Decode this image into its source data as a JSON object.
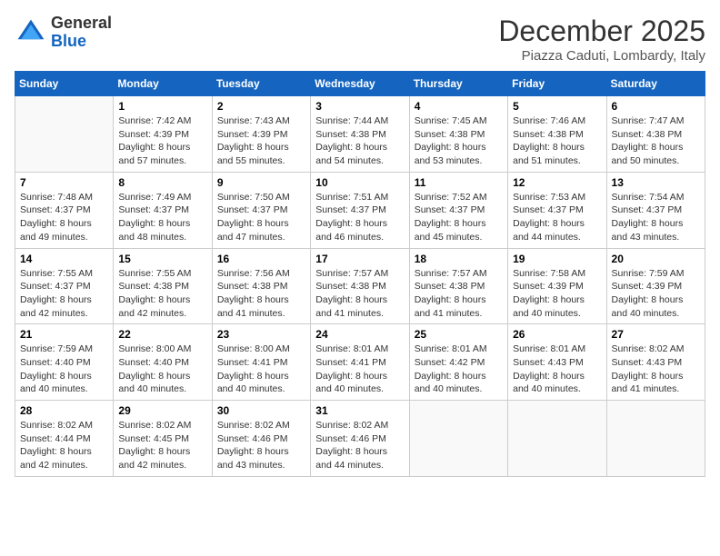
{
  "header": {
    "logo_general": "General",
    "logo_blue": "Blue",
    "month_title": "December 2025",
    "location": "Piazza Caduti, Lombardy, Italy"
  },
  "days_of_week": [
    "Sunday",
    "Monday",
    "Tuesday",
    "Wednesday",
    "Thursday",
    "Friday",
    "Saturday"
  ],
  "weeks": [
    [
      {
        "day": "",
        "sunrise": "",
        "sunset": "",
        "daylight": ""
      },
      {
        "day": "1",
        "sunrise": "Sunrise: 7:42 AM",
        "sunset": "Sunset: 4:39 PM",
        "daylight": "Daylight: 8 hours and 57 minutes."
      },
      {
        "day": "2",
        "sunrise": "Sunrise: 7:43 AM",
        "sunset": "Sunset: 4:39 PM",
        "daylight": "Daylight: 8 hours and 55 minutes."
      },
      {
        "day": "3",
        "sunrise": "Sunrise: 7:44 AM",
        "sunset": "Sunset: 4:38 PM",
        "daylight": "Daylight: 8 hours and 54 minutes."
      },
      {
        "day": "4",
        "sunrise": "Sunrise: 7:45 AM",
        "sunset": "Sunset: 4:38 PM",
        "daylight": "Daylight: 8 hours and 53 minutes."
      },
      {
        "day": "5",
        "sunrise": "Sunrise: 7:46 AM",
        "sunset": "Sunset: 4:38 PM",
        "daylight": "Daylight: 8 hours and 51 minutes."
      },
      {
        "day": "6",
        "sunrise": "Sunrise: 7:47 AM",
        "sunset": "Sunset: 4:38 PM",
        "daylight": "Daylight: 8 hours and 50 minutes."
      }
    ],
    [
      {
        "day": "7",
        "sunrise": "Sunrise: 7:48 AM",
        "sunset": "Sunset: 4:37 PM",
        "daylight": "Daylight: 8 hours and 49 minutes."
      },
      {
        "day": "8",
        "sunrise": "Sunrise: 7:49 AM",
        "sunset": "Sunset: 4:37 PM",
        "daylight": "Daylight: 8 hours and 48 minutes."
      },
      {
        "day": "9",
        "sunrise": "Sunrise: 7:50 AM",
        "sunset": "Sunset: 4:37 PM",
        "daylight": "Daylight: 8 hours and 47 minutes."
      },
      {
        "day": "10",
        "sunrise": "Sunrise: 7:51 AM",
        "sunset": "Sunset: 4:37 PM",
        "daylight": "Daylight: 8 hours and 46 minutes."
      },
      {
        "day": "11",
        "sunrise": "Sunrise: 7:52 AM",
        "sunset": "Sunset: 4:37 PM",
        "daylight": "Daylight: 8 hours and 45 minutes."
      },
      {
        "day": "12",
        "sunrise": "Sunrise: 7:53 AM",
        "sunset": "Sunset: 4:37 PM",
        "daylight": "Daylight: 8 hours and 44 minutes."
      },
      {
        "day": "13",
        "sunrise": "Sunrise: 7:54 AM",
        "sunset": "Sunset: 4:37 PM",
        "daylight": "Daylight: 8 hours and 43 minutes."
      }
    ],
    [
      {
        "day": "14",
        "sunrise": "Sunrise: 7:55 AM",
        "sunset": "Sunset: 4:37 PM",
        "daylight": "Daylight: 8 hours and 42 minutes."
      },
      {
        "day": "15",
        "sunrise": "Sunrise: 7:55 AM",
        "sunset": "Sunset: 4:38 PM",
        "daylight": "Daylight: 8 hours and 42 minutes."
      },
      {
        "day": "16",
        "sunrise": "Sunrise: 7:56 AM",
        "sunset": "Sunset: 4:38 PM",
        "daylight": "Daylight: 8 hours and 41 minutes."
      },
      {
        "day": "17",
        "sunrise": "Sunrise: 7:57 AM",
        "sunset": "Sunset: 4:38 PM",
        "daylight": "Daylight: 8 hours and 41 minutes."
      },
      {
        "day": "18",
        "sunrise": "Sunrise: 7:57 AM",
        "sunset": "Sunset: 4:38 PM",
        "daylight": "Daylight: 8 hours and 41 minutes."
      },
      {
        "day": "19",
        "sunrise": "Sunrise: 7:58 AM",
        "sunset": "Sunset: 4:39 PM",
        "daylight": "Daylight: 8 hours and 40 minutes."
      },
      {
        "day": "20",
        "sunrise": "Sunrise: 7:59 AM",
        "sunset": "Sunset: 4:39 PM",
        "daylight": "Daylight: 8 hours and 40 minutes."
      }
    ],
    [
      {
        "day": "21",
        "sunrise": "Sunrise: 7:59 AM",
        "sunset": "Sunset: 4:40 PM",
        "daylight": "Daylight: 8 hours and 40 minutes."
      },
      {
        "day": "22",
        "sunrise": "Sunrise: 8:00 AM",
        "sunset": "Sunset: 4:40 PM",
        "daylight": "Daylight: 8 hours and 40 minutes."
      },
      {
        "day": "23",
        "sunrise": "Sunrise: 8:00 AM",
        "sunset": "Sunset: 4:41 PM",
        "daylight": "Daylight: 8 hours and 40 minutes."
      },
      {
        "day": "24",
        "sunrise": "Sunrise: 8:01 AM",
        "sunset": "Sunset: 4:41 PM",
        "daylight": "Daylight: 8 hours and 40 minutes."
      },
      {
        "day": "25",
        "sunrise": "Sunrise: 8:01 AM",
        "sunset": "Sunset: 4:42 PM",
        "daylight": "Daylight: 8 hours and 40 minutes."
      },
      {
        "day": "26",
        "sunrise": "Sunrise: 8:01 AM",
        "sunset": "Sunset: 4:43 PM",
        "daylight": "Daylight: 8 hours and 40 minutes."
      },
      {
        "day": "27",
        "sunrise": "Sunrise: 8:02 AM",
        "sunset": "Sunset: 4:43 PM",
        "daylight": "Daylight: 8 hours and 41 minutes."
      }
    ],
    [
      {
        "day": "28",
        "sunrise": "Sunrise: 8:02 AM",
        "sunset": "Sunset: 4:44 PM",
        "daylight": "Daylight: 8 hours and 42 minutes."
      },
      {
        "day": "29",
        "sunrise": "Sunrise: 8:02 AM",
        "sunset": "Sunset: 4:45 PM",
        "daylight": "Daylight: 8 hours and 42 minutes."
      },
      {
        "day": "30",
        "sunrise": "Sunrise: 8:02 AM",
        "sunset": "Sunset: 4:46 PM",
        "daylight": "Daylight: 8 hours and 43 minutes."
      },
      {
        "day": "31",
        "sunrise": "Sunrise: 8:02 AM",
        "sunset": "Sunset: 4:46 PM",
        "daylight": "Daylight: 8 hours and 44 minutes."
      },
      {
        "day": "",
        "sunrise": "",
        "sunset": "",
        "daylight": ""
      },
      {
        "day": "",
        "sunrise": "",
        "sunset": "",
        "daylight": ""
      },
      {
        "day": "",
        "sunrise": "",
        "sunset": "",
        "daylight": ""
      }
    ]
  ]
}
